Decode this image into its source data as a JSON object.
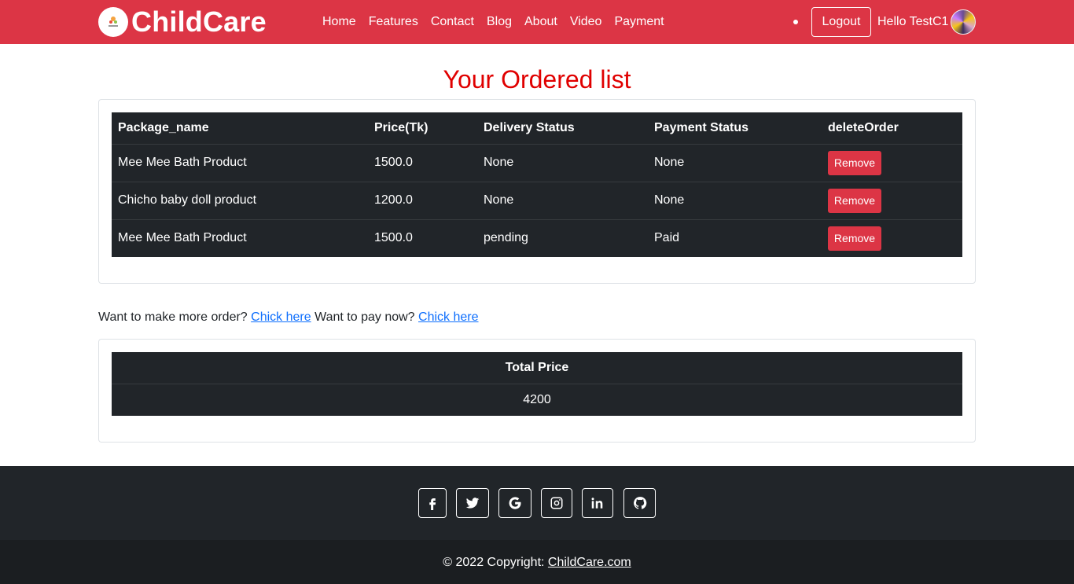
{
  "navbar": {
    "brand": "ChildCare",
    "links": [
      "Home",
      "Features",
      "Contact",
      "Blog",
      "About",
      "Video",
      "Payment"
    ],
    "logout_label": "Logout",
    "greeting": "Hello TestC1"
  },
  "page_title": "Your Ordered list",
  "orders": {
    "headers": [
      "Package_name",
      "Price(Tk)",
      "Delivery Status",
      "Payment Status",
      "deleteOrder"
    ],
    "rows": [
      {
        "package": "Mee Mee Bath Product",
        "price": "1500.0",
        "delivery": "None",
        "payment": "None",
        "action": "Remove"
      },
      {
        "package": "Chicho baby doll product",
        "price": "1200.0",
        "delivery": "None",
        "payment": "None",
        "action": "Remove"
      },
      {
        "package": "Mee Mee Bath Product",
        "price": "1500.0",
        "delivery": "pending",
        "payment": "Paid",
        "action": "Remove"
      }
    ]
  },
  "more_links": {
    "order_prompt": "Want to make more order?",
    "order_link": "Chick here",
    "pay_prompt": "Want to pay now?",
    "pay_link": "Chick here"
  },
  "total": {
    "header": "Total Price",
    "value": "4200"
  },
  "footer": {
    "social_icons": [
      "facebook-icon",
      "twitter-icon",
      "google-icon",
      "instagram-icon",
      "linkedin-icon",
      "github-icon"
    ],
    "copyright_prefix": "© 2022 Copyright:",
    "copyright_link": "ChildCare.com"
  },
  "colors": {
    "navbar": "#dc3545",
    "title": "#e00000",
    "table_dark": "#212529",
    "footer": "#212529",
    "link": "#0d6efd"
  }
}
